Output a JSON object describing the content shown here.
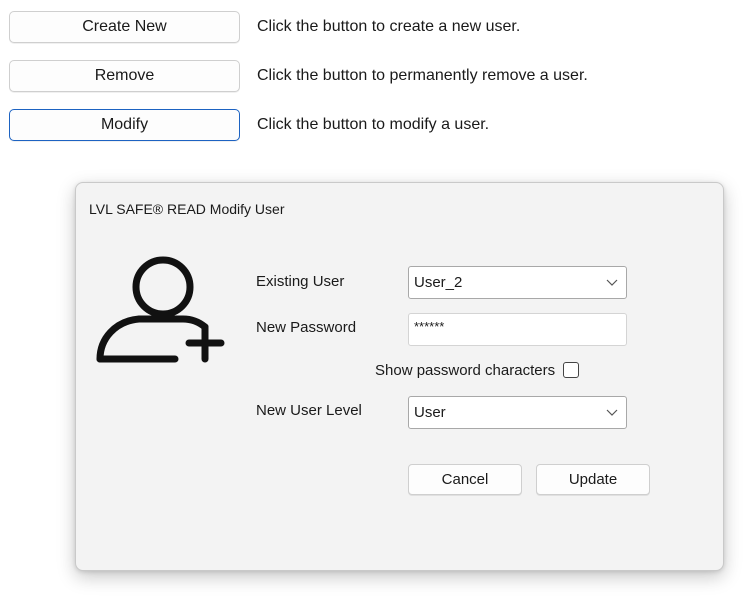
{
  "actions": [
    {
      "button_label": "Create New",
      "description": "Click the button to create a new user."
    },
    {
      "button_label": "Remove",
      "description": "Click the button to permanently remove a user."
    },
    {
      "button_label": "Modify",
      "description": "Click the button to modify a user."
    }
  ],
  "dialog": {
    "title": "LVL SAFE® READ Modify User",
    "icon": "user-add-icon",
    "existing_user_label": "Existing User",
    "existing_user_value": "User_2",
    "new_password_label": "New Password",
    "new_password_value": "******",
    "show_password_label": "Show password characters",
    "new_user_level_label": "New User Level",
    "new_user_level_value": "User",
    "cancel_label": "Cancel",
    "update_label": "Update"
  },
  "colors": {
    "focus_border": "#1d63c2",
    "dialog_background": "#f3f3f3"
  }
}
